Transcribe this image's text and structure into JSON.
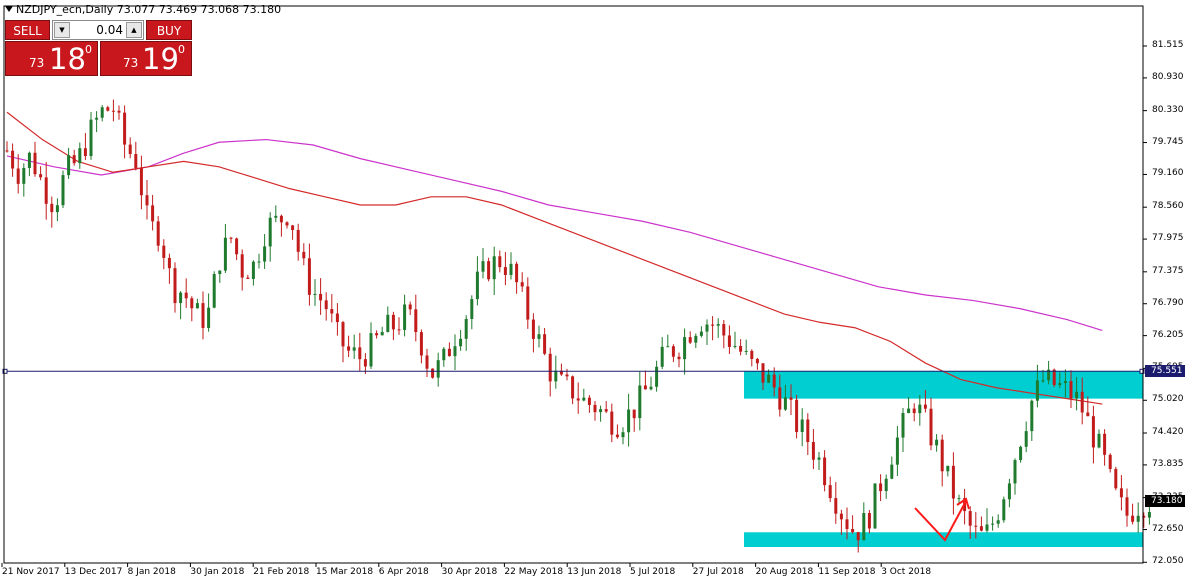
{
  "header": {
    "symbol_line": "NZDJPY_ecn,Daily  73.077 73.469 73.068 73.180"
  },
  "trade_panel": {
    "sell_label": "SELL",
    "buy_label": "BUY",
    "lot_value": "0.04",
    "sell_prefix": "73",
    "sell_big": "18",
    "sell_sup": "0",
    "buy_prefix": "73",
    "buy_big": "19",
    "buy_sup": "0"
  },
  "colors": {
    "bull": "#1f7a2e",
    "bear": "#c21b1b",
    "ma_red": "#d42a2a",
    "ma_magenta": "#cc33cc",
    "zone": "#00ced1",
    "hline": "#1c1c6e",
    "arrow": "#ff1a1a"
  },
  "price_tags": {
    "level": "75.551",
    "current": "73.180"
  },
  "chart_data": {
    "type": "candlestick",
    "title": "NZDJPY_ecn,Daily",
    "y_ticks": [
      "81.515",
      "80.930",
      "80.330",
      "79.745",
      "79.160",
      "78.560",
      "77.975",
      "77.375",
      "76.790",
      "76.205",
      "75.605",
      "75.020",
      "74.420",
      "73.835",
      "73.235",
      "72.650",
      "72.050"
    ],
    "ylim": [
      72.0,
      81.9
    ],
    "x_ticks": [
      "21 Nov 2017",
      "13 Dec 2017",
      "8 Jan 2018",
      "30 Jan 2018",
      "21 Feb 2018",
      "15 Mar 2018",
      "6 Apr 2018",
      "30 Apr 2018",
      "22 May 2018",
      "13 Jun 2018",
      "5 Jul 2018",
      "27 Jul 2018",
      "20 Aug 2018",
      "11 Sep 2018",
      "3 Oct 2018"
    ],
    "horizontal_level": 75.551,
    "last_price": 73.18,
    "zones": [
      {
        "from_date": "2018-08-15",
        "low": 75.05,
        "high": 75.55
      },
      {
        "from_date": "2018-08-15",
        "low": 72.33,
        "high": 72.6
      }
    ],
    "close_path": [
      79.6,
      79.2,
      79.5,
      79.0,
      78.6,
      79.2,
      79.4,
      79.9,
      80.3,
      80.4,
      79.7,
      79.4,
      78.2,
      78.1,
      77.1,
      77.0,
      76.6,
      76.5,
      77.6,
      78.0,
      77.4,
      77.5,
      78.2,
      78.3,
      78.5,
      77.5,
      77.0,
      76.8,
      76.2,
      75.9,
      75.8,
      76.0,
      76.3,
      76.4,
      76.6,
      76.2,
      75.5,
      75.7,
      76.2,
      76.6,
      77.2,
      77.5,
      77.6,
      77.3,
      76.7,
      76.2,
      75.6,
      75.3,
      75.2,
      75.0,
      74.9,
      74.7,
      74.6,
      74.8,
      75.1,
      75.5,
      75.9,
      76.0,
      76.3,
      76.5,
      76.4,
      76.2,
      76.0,
      75.7,
      75.5,
      75.3,
      75.0,
      74.6,
      74.3,
      73.9,
      73.4,
      72.9,
      72.6,
      72.8,
      73.4,
      74.0,
      74.5,
      75.0,
      74.6,
      74.1,
      73.5,
      73.0,
      72.6,
      72.5,
      72.9,
      73.6,
      74.3,
      75.0,
      75.4,
      75.3,
      75.2,
      75.0,
      74.5,
      74.0,
      73.3,
      72.9,
      73.1,
      73.18
    ],
    "ma_red": [
      [
        0,
        80.3
      ],
      [
        3,
        79.8
      ],
      [
        6,
        79.4
      ],
      [
        9,
        79.2
      ],
      [
        12,
        79.3
      ],
      [
        15,
        79.4
      ],
      [
        18,
        79.3
      ],
      [
        21,
        79.1
      ],
      [
        24,
        78.9
      ],
      [
        27,
        78.75
      ],
      [
        30,
        78.6
      ],
      [
        33,
        78.6
      ],
      [
        36,
        78.75
      ],
      [
        39,
        78.75
      ],
      [
        42,
        78.6
      ],
      [
        45,
        78.35
      ],
      [
        48,
        78.1
      ],
      [
        51,
        77.85
      ],
      [
        54,
        77.6
      ],
      [
        57,
        77.35
      ],
      [
        60,
        77.1
      ],
      [
        63,
        76.85
      ],
      [
        66,
        76.6
      ],
      [
        69,
        76.45
      ],
      [
        72,
        76.35
      ],
      [
        75,
        76.1
      ],
      [
        78,
        75.7
      ],
      [
        81,
        75.4
      ],
      [
        84,
        75.25
      ],
      [
        87,
        75.15
      ],
      [
        90,
        75.05
      ],
      [
        93,
        74.95
      ]
    ],
    "ma_magenta": [
      [
        0,
        79.5
      ],
      [
        4,
        79.3
      ],
      [
        8,
        79.15
      ],
      [
        12,
        79.3
      ],
      [
        15,
        79.55
      ],
      [
        18,
        79.75
      ],
      [
        22,
        79.8
      ],
      [
        26,
        79.7
      ],
      [
        30,
        79.45
      ],
      [
        34,
        79.25
      ],
      [
        38,
        79.05
      ],
      [
        42,
        78.85
      ],
      [
        46,
        78.6
      ],
      [
        50,
        78.45
      ],
      [
        54,
        78.3
      ],
      [
        58,
        78.1
      ],
      [
        62,
        77.85
      ],
      [
        66,
        77.6
      ],
      [
        70,
        77.35
      ],
      [
        74,
        77.1
      ],
      [
        78,
        76.95
      ],
      [
        82,
        76.85
      ],
      [
        86,
        76.7
      ],
      [
        90,
        76.5
      ],
      [
        93,
        76.3
      ]
    ],
    "grid": false,
    "legend": "none"
  }
}
